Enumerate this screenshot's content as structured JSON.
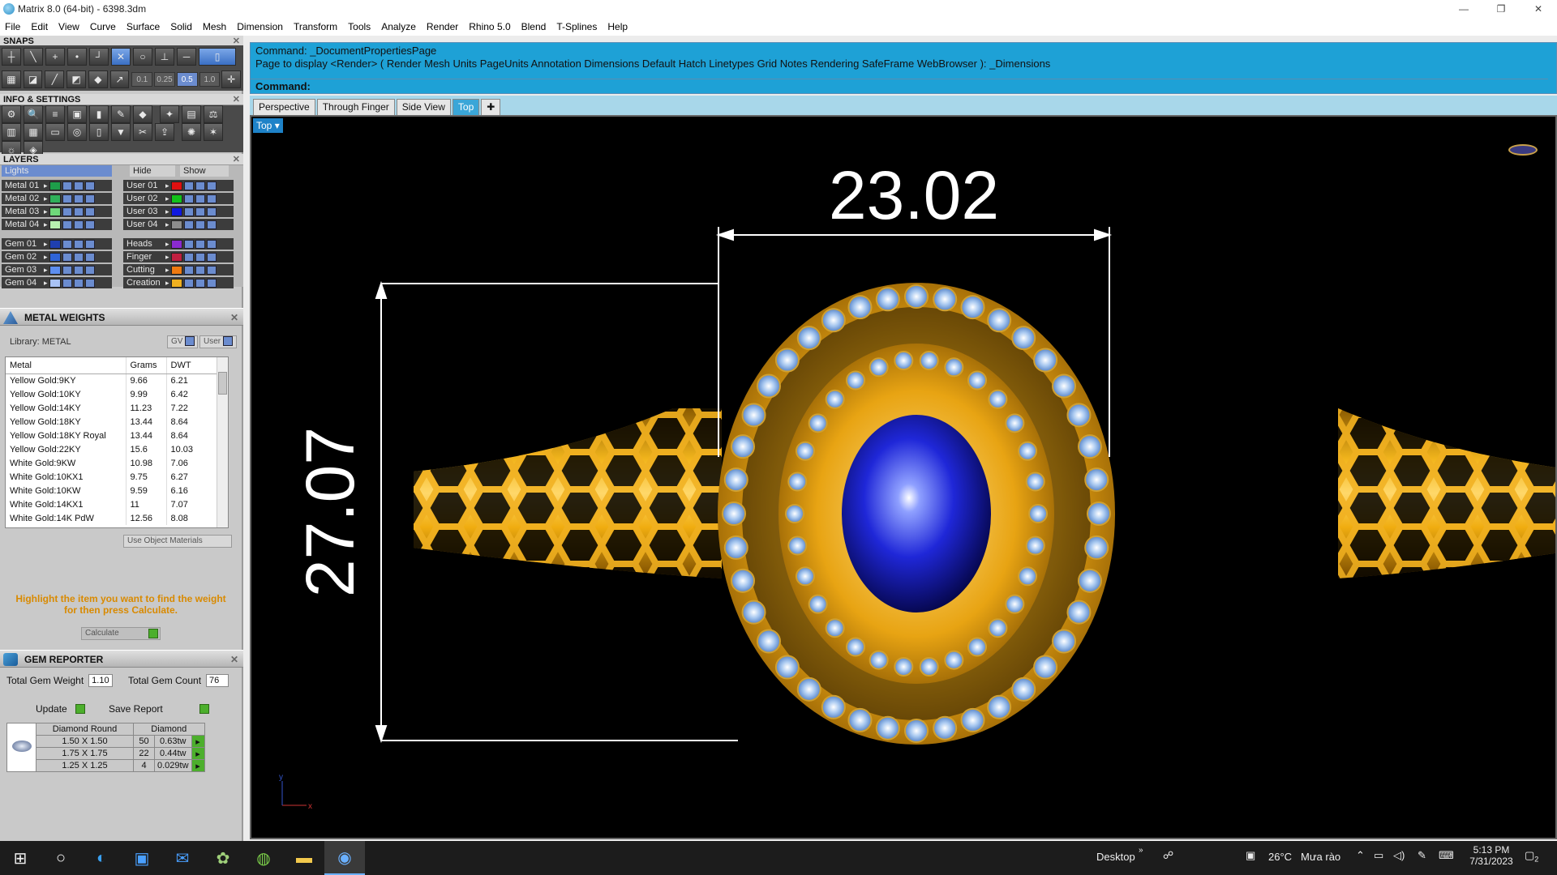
{
  "window": {
    "title": "Matrix 8.0 (64-bit) - 6398.3dm",
    "controls": [
      "—",
      "❐",
      "✕"
    ]
  },
  "menu": [
    "File",
    "Edit",
    "View",
    "Curve",
    "Surface",
    "Solid",
    "Mesh",
    "Dimension",
    "Transform",
    "Tools",
    "Analyze",
    "Render",
    "Rhino 5.0",
    "Blend",
    "T-Splines",
    "Help"
  ],
  "snaps": {
    "title": "SNAPS",
    "values": [
      "0.1",
      "0.25",
      "0.5",
      "1.0"
    ]
  },
  "info": {
    "title": "INFO & SETTINGS"
  },
  "layers": {
    "title": "LAYERS",
    "lights_label": "Lights",
    "hide_label": "Hide",
    "show_label": "Show",
    "left": [
      {
        "name": "Metal 01",
        "color": "#1e9e4a"
      },
      {
        "name": "Metal 02",
        "color": "#2fb05a"
      },
      {
        "name": "Metal 03",
        "color": "#6fd87a"
      },
      {
        "name": "Metal 04",
        "color": "#b8f0b0"
      },
      {
        "name": "Gem 01",
        "color": "#1f3fb0"
      },
      {
        "name": "Gem 02",
        "color": "#2f64d8"
      },
      {
        "name": "Gem 03",
        "color": "#5d8ef0"
      },
      {
        "name": "Gem 04",
        "color": "#a9c3f5"
      }
    ],
    "right": [
      {
        "name": "User 01",
        "color": "#e01010"
      },
      {
        "name": "User 02",
        "color": "#12c21a"
      },
      {
        "name": "User 03",
        "color": "#1018e0"
      },
      {
        "name": "User 04",
        "color": "#8c8c8c"
      },
      {
        "name": "Heads",
        "color": "#8a2ad0"
      },
      {
        "name": "Finger",
        "color": "#c02040"
      },
      {
        "name": "Cutting",
        "color": "#f07a10"
      },
      {
        "name": "Creation",
        "color": "#f0b020"
      }
    ]
  },
  "metal_weights": {
    "title": "METAL WEIGHTS",
    "library": "Library: METAL",
    "gv_label": "GV",
    "user_label": "User",
    "headers": [
      "Metal",
      "Grams",
      "DWT"
    ],
    "rows": [
      [
        "Yellow Gold:9KY",
        "9.66",
        "6.21"
      ],
      [
        "Yellow Gold:10KY",
        "9.99",
        "6.42"
      ],
      [
        "Yellow Gold:14KY",
        "11.23",
        "7.22"
      ],
      [
        "Yellow Gold:18KY",
        "13.44",
        "8.64"
      ],
      [
        "Yellow Gold:18KY Royal",
        "13.44",
        "8.64"
      ],
      [
        "Yellow Gold:22KY",
        "15.6",
        "10.03"
      ],
      [
        "White Gold:9KW",
        "10.98",
        "7.06"
      ],
      [
        "White Gold:10KX1",
        "9.75",
        "6.27"
      ],
      [
        "White Gold:10KW",
        "9.59",
        "6.16"
      ],
      [
        "White Gold:14KX1",
        "11",
        "7.07"
      ],
      [
        "White Gold:14K PdW",
        "12.56",
        "8.08"
      ]
    ],
    "use_object_materials": "Use Object Materials",
    "hint": "Highlight the item you want to find the weight for then press Calculate.",
    "calculate": "Calculate"
  },
  "gem_reporter": {
    "title": "GEM REPORTER",
    "total_weight_label": "Total Gem Weight",
    "total_weight": "1.10",
    "total_count_label": "Total Gem Count",
    "total_count": "76",
    "update": "Update",
    "save_report": "Save Report",
    "headers": [
      "Diamond Round",
      "Diamond"
    ],
    "rows": [
      [
        "1.50 X 1.50",
        "50",
        "0.63tw"
      ],
      [
        "1.75 X 1.75",
        "22",
        "0.44tw"
      ],
      [
        "1.25 X 1.25",
        "4",
        "0.029tw"
      ]
    ]
  },
  "command": {
    "line1": "Command: _DocumentPropertiesPage",
    "line2": "Page to display <Render> ( Render  Mesh  Units  PageUnits  Annotation  Dimensions  Default  Hatch  Linetypes  Grid  Notes  Rendering  SafeFrame  WebBrowser ): _Dimensions",
    "prompt": "Command:"
  },
  "viewtabs": [
    "Perspective",
    "Through Finger",
    "Side View",
    "Top"
  ],
  "active_view": "Top",
  "viewport": {
    "label": "Top",
    "dim_width": "23.02",
    "dim_height": "27.07"
  },
  "taskbar": {
    "desktop": "Desktop",
    "temp": "26°C",
    "weather": "Mưa rào",
    "time": "5:13 PM",
    "date": "7/31/2023",
    "notif": "2"
  }
}
